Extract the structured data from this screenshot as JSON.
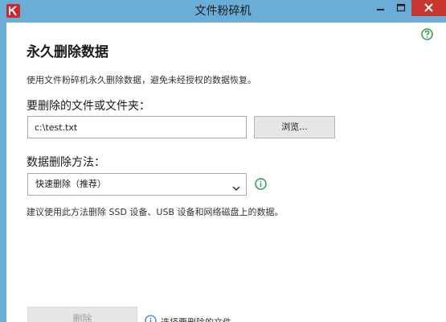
{
  "window": {
    "title": "文件粉碎机",
    "close_color": "#c7372f",
    "frame_color": "#6aaed8"
  },
  "help": {
    "icon": "help-icon"
  },
  "main": {
    "title": "永久删除数据",
    "description": "使用文件粉碎机永久删除数据，避免未经授权的数据恢复。",
    "files_label": "要删除的文件或文件夹：",
    "path_value": "c:\\test.txt",
    "browse_label": "浏览...",
    "method_label": "数据删除方法：",
    "method_selected": "快速删除（推荐）",
    "method_info_icon": "info-icon",
    "recommendation": "建议使用此方法删除 SSD 设备、USB 设备和网络磁盘上的数据。",
    "delete_label": "删除",
    "hint_text": "选择要删除的文件"
  },
  "colors": {
    "accent_green": "#2e9a47",
    "disabled_text": "#a0a0a0"
  }
}
